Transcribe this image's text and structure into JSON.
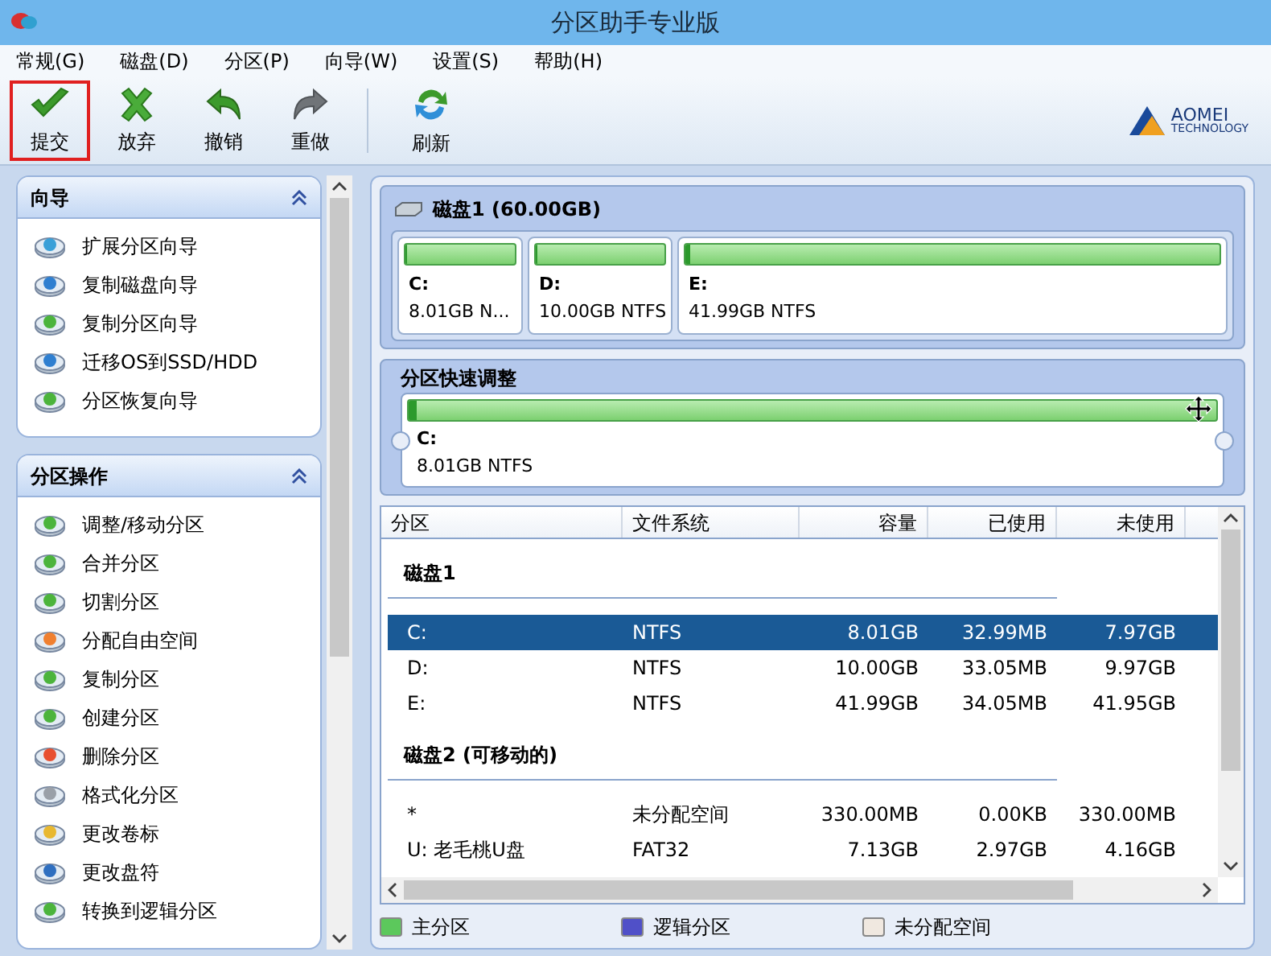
{
  "window": {
    "title": "分区助手专业版"
  },
  "menu": [
    {
      "label": "常规(G)"
    },
    {
      "label": "磁盘(D)"
    },
    {
      "label": "分区(P)"
    },
    {
      "label": "向导(W)"
    },
    {
      "label": "设置(S)"
    },
    {
      "label": "帮助(H)"
    }
  ],
  "toolbar": [
    {
      "label": "提交",
      "kind": "commit",
      "highlighted": true
    },
    {
      "label": "放弃",
      "kind": "discard",
      "highlighted": false
    },
    {
      "label": "撤销",
      "kind": "undo",
      "highlighted": false
    },
    {
      "label": "重做",
      "kind": "redo",
      "highlighted": false
    },
    {
      "label": "刷新",
      "kind": "refresh",
      "highlighted": false
    }
  ],
  "logo": {
    "name": "AOMEI",
    "sub": "TECHNOLOGY"
  },
  "sidebar": {
    "sections": [
      {
        "title": "向导",
        "expanded": true,
        "items": [
          {
            "label": "扩展分区向导",
            "color": "#3aa0d8"
          },
          {
            "label": "复制磁盘向导",
            "color": "#2f7fd0"
          },
          {
            "label": "复制分区向导",
            "color": "#4cb43c"
          },
          {
            "label": "迁移OS到SSD/HDD",
            "color": "#2f7fd0"
          },
          {
            "label": "分区恢复向导",
            "color": "#4cb43c"
          }
        ]
      },
      {
        "title": "分区操作",
        "expanded": true,
        "items": [
          {
            "label": "调整/移动分区",
            "color": "#4cb43c"
          },
          {
            "label": "合并分区",
            "color": "#4cb43c"
          },
          {
            "label": "切割分区",
            "color": "#4cb43c"
          },
          {
            "label": "分配自由空间",
            "color": "#f08030"
          },
          {
            "label": "复制分区",
            "color": "#4cb43c"
          },
          {
            "label": "创建分区",
            "color": "#4cb43c"
          },
          {
            "label": "删除分区",
            "color": "#e85030"
          },
          {
            "label": "格式化分区",
            "color": "#9aa0a8"
          },
          {
            "label": "更改卷标",
            "color": "#e8b830"
          },
          {
            "label": "更改盘符",
            "color": "#2f6fc0"
          },
          {
            "label": "转换到逻辑分区",
            "color": "#4cb43c"
          }
        ]
      }
    ]
  },
  "disk_map": {
    "title": "磁盘1 (60.00GB)",
    "partitions": [
      {
        "letter": "C:",
        "info": "8.01GB N...",
        "level": 0.01
      },
      {
        "letter": "D:",
        "info": "10.00GB NTFS",
        "level": 0.01
      },
      {
        "letter": "E:",
        "info": "41.99GB NTFS",
        "level": 0.01
      }
    ]
  },
  "quick_resize": {
    "title": "分区快速调整",
    "letter": "C:",
    "info": "8.01GB NTFS",
    "level": 0.01
  },
  "table": {
    "columns": [
      "分区",
      "文件系统",
      "容量",
      "已使用",
      "未使用"
    ],
    "groups": [
      {
        "title": "磁盘1",
        "rows": [
          {
            "cells": [
              "C:",
              "NTFS",
              "8.01GB",
              "32.99MB",
              "7.97GB"
            ],
            "selected": true
          },
          {
            "cells": [
              "D:",
              "NTFS",
              "10.00GB",
              "33.05MB",
              "9.97GB"
            ],
            "selected": false
          },
          {
            "cells": [
              "E:",
              "NTFS",
              "41.99GB",
              "34.05MB",
              "41.95GB"
            ],
            "selected": false
          }
        ]
      },
      {
        "title": "磁盘2 (可移动的)",
        "rows": [
          {
            "cells": [
              "*",
              "未分配空间",
              "330.00MB",
              "0.00KB",
              "330.00MB"
            ],
            "selected": false
          },
          {
            "cells": [
              "U: 老毛桃U盘",
              "FAT32",
              "7.13GB",
              "2.97GB",
              "4.16GB"
            ],
            "selected": false
          }
        ]
      }
    ]
  },
  "legend": [
    {
      "label": "主分区",
      "color": "#5cc85c"
    },
    {
      "label": "逻辑分区",
      "color": "#5050c8"
    },
    {
      "label": "未分配空间",
      "color": "#f0e8e0"
    }
  ]
}
